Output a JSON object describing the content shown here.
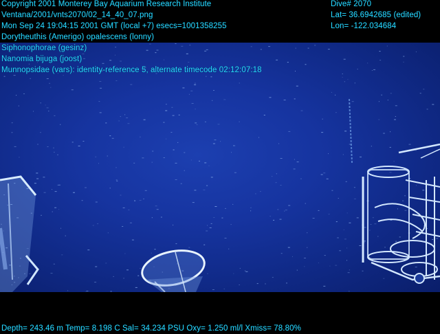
{
  "overlay": {
    "copyright": "Copyright 2001 Monterey Bay Aquarium Research Institute",
    "file_path": "Ventana/2001/vnts2070/02_14_40_07.png",
    "timestamp": "Mon Sep 24 19:04:15 2001 GMT (local +7)  esecs=1001358255",
    "annotations": [
      "Dorytheuthis (Amerigo) opalescens (lonny)",
      "Siphonophorae (gesinz)",
      "Nanomia bijuga (joost)",
      "Munnopsidae (vars): identity-reference 5, alternate timecode 02:12:07:18"
    ],
    "dive": "Dive# 2070",
    "lat": "Lat= 36.6942685 (edited)",
    "lon": "Lon= -122.034684",
    "sensors": "Depth= 243.46 m  Temp= 8.198 C  Sal= 34.234 PSU  Oxy= 1.250 ml/l  Xmiss= 78.80%"
  },
  "colors": {
    "overlay_text": "#27d7ff",
    "water": "#1634a0",
    "letterbox": "#000000"
  }
}
